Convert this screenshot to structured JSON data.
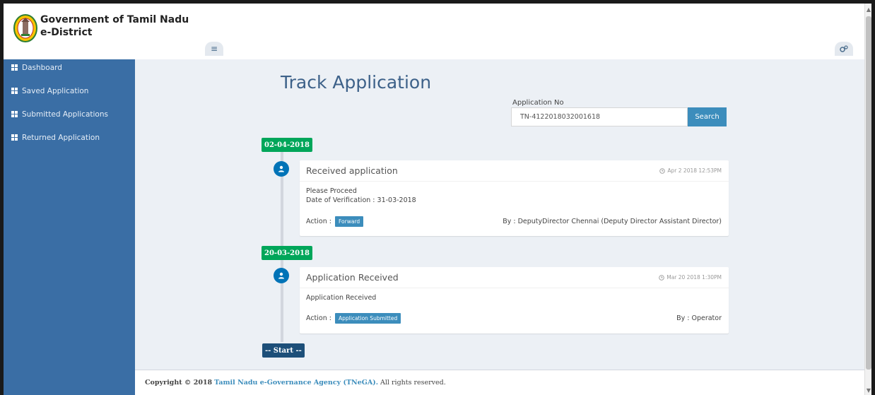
{
  "header": {
    "brand_line1": "Government of Tamil Nadu",
    "brand_line2": "e-District",
    "menu_icon": "hamburger-icon",
    "settings_icon": "gears-icon"
  },
  "sidebar": {
    "items": [
      {
        "label": "Dashboard"
      },
      {
        "label": "Saved Application"
      },
      {
        "label": "Submitted Applications"
      },
      {
        "label": "Returned Application"
      }
    ],
    "icon": "grid-icon"
  },
  "main": {
    "title": "Track Application",
    "application_no_label": "Application No",
    "application_no_value": "TN-4122018032001618",
    "search_label": "Search"
  },
  "timeline": {
    "entries": [
      {
        "date": "02-04-2018",
        "title": "Received application",
        "time": "Apr 2 2018 12:53PM",
        "body_line1": "Please Proceed",
        "body_line2": "Date of Verification : 31-03-2018",
        "action_label": "Action :",
        "action": "Forward",
        "by": "By : DeputyDirector Chennai (Deputy Director Assistant Director)"
      },
      {
        "date": "20-03-2018",
        "title": "Application Received",
        "time": "Mar 20 2018 1:30PM",
        "body_line1": "Application Received",
        "action_label": "Action :",
        "action": "Application Submitted",
        "by": "By : Operator"
      }
    ],
    "start_label": "-- Start --"
  },
  "footer": {
    "copyright": "Copyright © 2018",
    "agency": "Tamil Nadu e-Governance Agency (TNeGA).",
    "rights": "All rights reserved."
  },
  "colors": {
    "sidebar": "#3a6ea5",
    "accent": "#3c8dbc",
    "date_badge": "#00a65a",
    "start_badge": "#1d4f79",
    "title": "#3d6189"
  }
}
